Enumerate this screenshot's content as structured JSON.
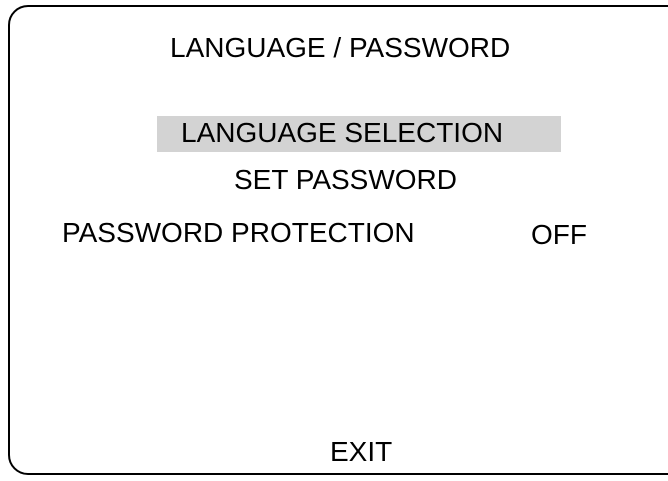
{
  "menu": {
    "title": "LANGUAGE / PASSWORD",
    "items": [
      {
        "label": "LANGUAGE SELECTION",
        "selected": true
      },
      {
        "label": "SET PASSWORD",
        "selected": false
      }
    ],
    "password_protection": {
      "label": "PASSWORD PROTECTION",
      "value": "OFF"
    },
    "exit_label": "EXIT"
  },
  "colors": {
    "background": "#ffffff",
    "text": "#000000",
    "highlight": "#d3d3d3",
    "border": "#000000"
  }
}
